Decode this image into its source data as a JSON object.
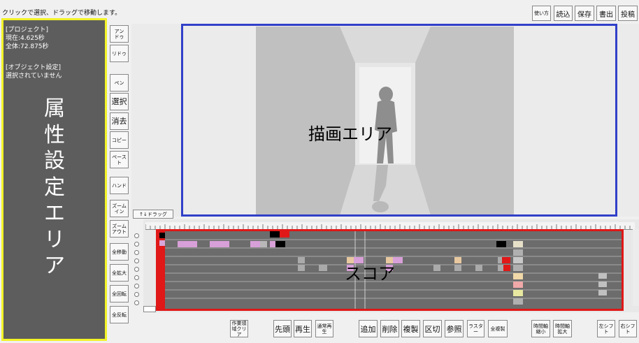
{
  "hint": "クリックで選択、ドラッグで移動します。",
  "toolbar": [
    {
      "label": "使い方"
    },
    {
      "label": "読込"
    },
    {
      "label": "保存"
    },
    {
      "label": "書出"
    },
    {
      "label": "投稿"
    }
  ],
  "left_panel": {
    "project_header": "[プロジェクト]",
    "current": "現在:4.625秒",
    "total": "全体:72.875秒",
    "object_header": "[オブジェクト設定]",
    "object_status": "選択されていません",
    "annotation_chars": [
      "属",
      "性",
      "設",
      "定",
      "エ",
      "リ",
      "ア"
    ]
  },
  "tools": [
    "アン\nドゥ",
    "リドゥ",
    "ペン",
    "選択",
    "消去",
    "コピー",
    "ペースト",
    "ハンド",
    "ズーム\nイン",
    "ズーム\nアウト",
    "全移動",
    "全拡大",
    "全回転",
    "全反転"
  ],
  "canvas_annotation": "描画エリア",
  "score": {
    "drag_tab": "↑↓ドラッグ",
    "annotation": "スコア"
  },
  "bottom_buttons": [
    {
      "label": "作業領\n域クリア"
    },
    {
      "label": "先頭"
    },
    {
      "label": "再生"
    },
    {
      "label": "通常再\n生"
    },
    {
      "label": "追加"
    },
    {
      "label": "削除"
    },
    {
      "label": "複製"
    },
    {
      "label": "区切"
    },
    {
      "label": "参照"
    },
    {
      "label": "ラスタ\nー"
    },
    {
      "label": "全複製"
    },
    {
      "label": "時間軸\n縮小"
    },
    {
      "label": "時間軸\n拡大"
    },
    {
      "label": "左シフ\nト"
    },
    {
      "label": "右シフ\nト"
    }
  ],
  "colors": {
    "highlight_yellow": "#f2f228",
    "canvas_blue": "#3140c8",
    "score_red": "#e01818"
  }
}
